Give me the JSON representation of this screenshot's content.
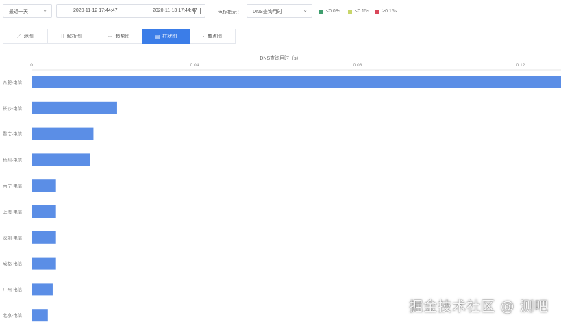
{
  "toolbar": {
    "period_select": "最近一天",
    "start_time": "2020-11-12 17:44:47",
    "end_time": "2020-11-13 17:44:47",
    "metric_label": "色标指示：",
    "metric_select": "DNS查询用时",
    "legend": [
      {
        "label": "<0.08s",
        "color": "#3f9e6e"
      },
      {
        "label": "<0.15s",
        "color": "#c8d66a"
      },
      {
        "label": ">0.15s",
        "color": "#d9475a"
      }
    ]
  },
  "tabs": [
    {
      "label": "地图",
      "icon": "map-icon"
    },
    {
      "label": "解析图",
      "icon": "parse-icon"
    },
    {
      "label": "趋势图",
      "icon": "trend-icon"
    },
    {
      "label": "柱状图",
      "icon": "bar-chart-icon",
      "active": true
    },
    {
      "label": "散点图",
      "icon": "scatter-icon"
    }
  ],
  "chart_data": {
    "type": "bar",
    "orientation": "horizontal",
    "xlabel": "DNS查询用时（s）",
    "xticks": [
      "0",
      "0.04",
      "0.08",
      "0.12"
    ],
    "xlim": [
      0,
      0.12
    ],
    "color": "#5b8ee6",
    "categories": [
      "合肥-电信",
      "长沙-电信",
      "重庆-电信",
      "杭州-电信",
      "南宁-电信",
      "上海-电信",
      "深圳-电信",
      "成都-电信",
      "广州-电信",
      "北京-电信"
    ],
    "values": [
      0.131,
      0.021,
      0.0152,
      0.0143,
      0.006,
      0.006,
      0.006,
      0.006,
      0.0052,
      0.004
    ]
  },
  "watermark": "掘金技术社区 @ 测吧"
}
